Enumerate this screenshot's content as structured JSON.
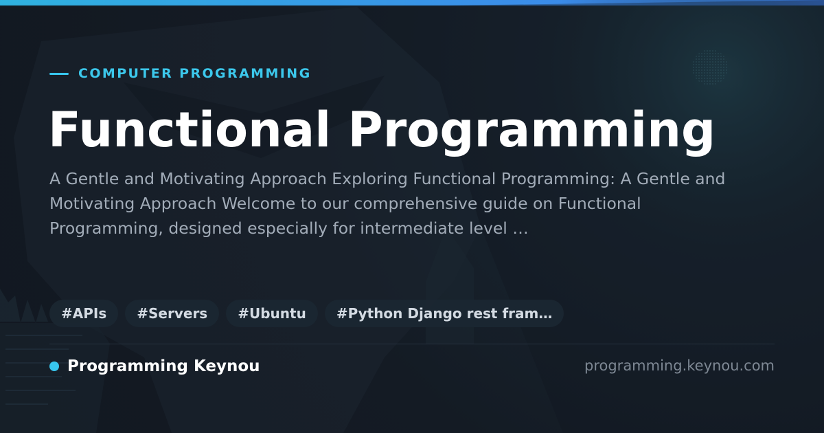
{
  "category": "COMPUTER PROGRAMMING",
  "title": "Functional Programming",
  "description": "A Gentle and Motivating Approach Exploring Functional Programming: A Gentle and Motivating Approach Welcome to our comprehensive guide on Functional Programming, designed especially for intermediate level …",
  "tags": [
    "#APIs",
    "#Servers",
    "#Ubuntu",
    "#Python Django rest fram…"
  ],
  "brand": {
    "name": "Programming Keynou",
    "domain": "programming.keynou.com"
  },
  "colors": {
    "accent": "#38c6ee",
    "top_bar_start": "#2fb2e0",
    "top_bar_end": "#3d7fee",
    "background": "#151c25",
    "title": "#ffffff",
    "description": "#a2acb8",
    "tag_background": "#1b2732",
    "tag_text": "#d4dbe3",
    "domain_text": "#7e8894"
  }
}
